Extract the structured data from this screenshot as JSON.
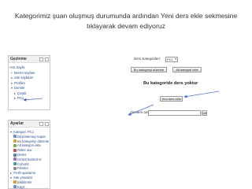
{
  "caption": {
    "line1": "Kategorimiz şuan oluşmuş durumunda ardından Yeni ders ekle sekmesine",
    "line2": "tıklayarak devam ediyoruz"
  },
  "navigation": {
    "title": "Gezinme",
    "items": [
      {
        "label": "Ana Sayfa",
        "marker": ""
      },
      {
        "label": "Benim sayfam",
        "marker": "•"
      },
      {
        "label": "Site sayfaları",
        "marker": "▸"
      },
      {
        "label": "Profilim",
        "marker": "▸"
      },
      {
        "label": "Dersler",
        "marker": "▾"
      },
      {
        "label": "Çeşitli",
        "marker": "▸"
      },
      {
        "label": "PC1",
        "marker": "▸"
      }
    ]
  },
  "settings": {
    "title": "Ayarlar",
    "items": [
      {
        "label": "Kategori: PC1",
        "marker": "▾",
        "icon": ""
      },
      {
        "label": "Düzenlemeyi kapat",
        "marker": "",
        "icon": "#6b8fcf"
      },
      {
        "label": "Bu kategoriyi düzenle",
        "marker": "",
        "icon": "#e0a030"
      },
      {
        "label": "Alt kategori ekle",
        "marker": "",
        "icon": "#7aaa4a"
      },
      {
        "label": "Roller ata",
        "marker": "",
        "icon": "#c05050"
      },
      {
        "label": "İzinler",
        "marker": "",
        "icon": "#5080b0"
      },
      {
        "label": "İzinleri kontrol et",
        "marker": "",
        "icon": "#a070b0"
      },
      {
        "label": "Cohorts",
        "marker": "",
        "icon": "#4a9a9a"
      },
      {
        "label": "Filtreler",
        "marker": "",
        "icon": "#909090"
      },
      {
        "label": "Profil ayarlarım",
        "marker": "▸",
        "icon": ""
      },
      {
        "label": "Site yönetimi",
        "marker": "▾",
        "icon": ""
      },
      {
        "label": "Bildirimler",
        "marker": "",
        "icon": "#e0a030"
      },
      {
        "label": "Kayıt",
        "marker": "",
        "icon": "#6b8fcf"
      }
    ]
  },
  "main": {
    "course_categories_label": "Ders Kategorileri:",
    "category_select_value": "PC1",
    "edit_category_button": "Bu kategoriyi düzenle",
    "add_subcategory_button": "Alt kategori ekle",
    "no_courses_message": "Bu kategoride ders yoktur",
    "add_new_course_button": "Yeni ders ekle",
    "search_label": "Dersleri ara:",
    "search_value": "",
    "go_button": "Git"
  },
  "colors": {
    "arrow": "#4a6fd0",
    "link": "#2a4d8f"
  }
}
